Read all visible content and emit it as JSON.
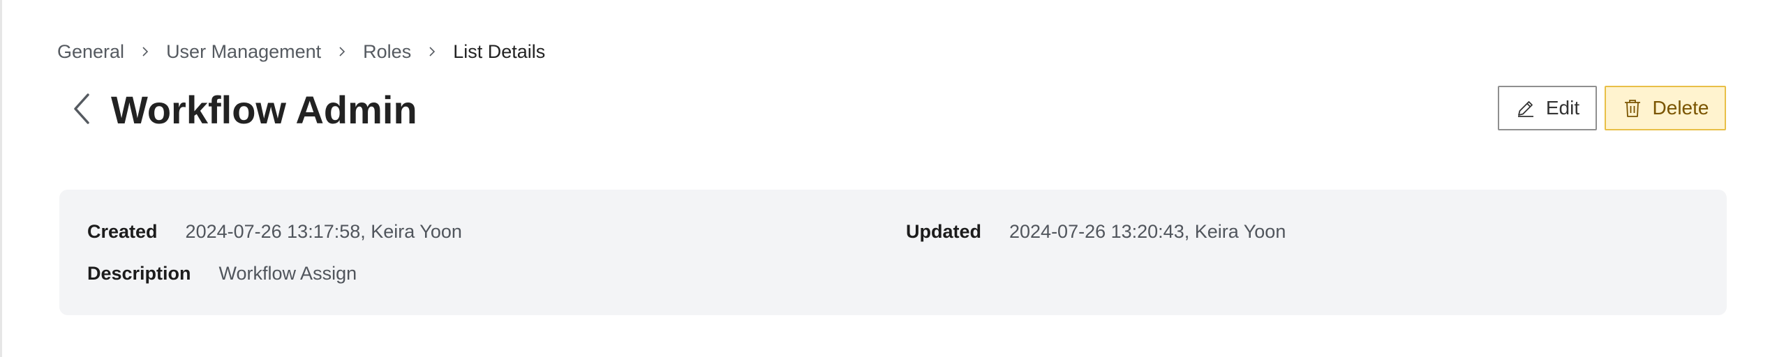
{
  "breadcrumb": {
    "items": [
      "General",
      "User Management",
      "Roles",
      "List Details"
    ]
  },
  "header": {
    "title": "Workflow Admin",
    "back_icon": "chevron-left-icon"
  },
  "actions": {
    "edit_label": "Edit",
    "edit_icon": "pencil-icon",
    "delete_label": "Delete",
    "delete_icon": "trash-icon"
  },
  "details": {
    "created_label": "Created",
    "created_value": "2024-07-26 13:17:58, Keira Yoon",
    "updated_label": "Updated",
    "updated_value": "2024-07-26 13:20:43, Keira Yoon",
    "description_label": "Description",
    "description_value": "Workflow Assign"
  },
  "colors": {
    "delete_bg": "#fff3cf",
    "delete_border": "#e8bf47",
    "panel_bg": "#f3f4f6"
  }
}
